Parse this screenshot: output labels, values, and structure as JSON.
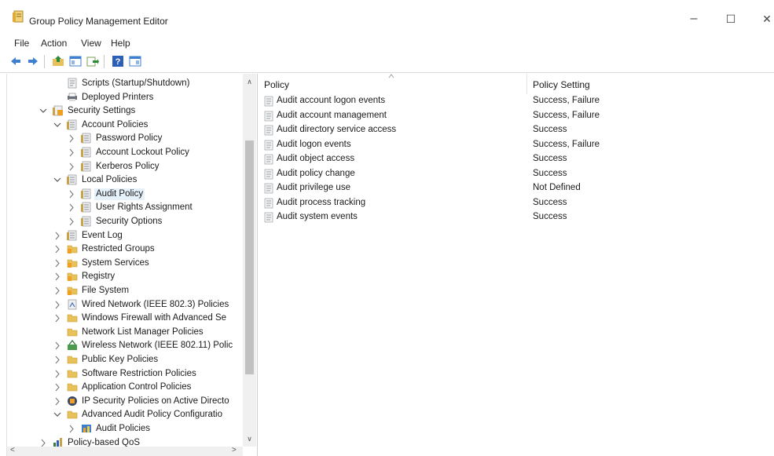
{
  "window": {
    "title": "Group Policy Management Editor",
    "minimize": "–",
    "maximize": "☐",
    "close": "✕"
  },
  "menu": [
    {
      "label": "File"
    },
    {
      "label": "Action"
    },
    {
      "label": "View"
    },
    {
      "label": "Help"
    }
  ],
  "toolbar": [
    {
      "name": "back-arrow-icon"
    },
    {
      "name": "forward-arrow-icon"
    },
    {
      "name": "up-folder-icon"
    },
    {
      "name": "show-hide-tree-icon"
    },
    {
      "name": "export-list-icon"
    },
    {
      "name": "help-icon"
    },
    {
      "name": "show-action-pane-icon"
    }
  ],
  "tree": [
    {
      "label": "Scripts (Startup/Shutdown)",
      "icon": "script-icon",
      "expand": ""
    },
    {
      "label": "Deployed Printers",
      "icon": "printer-icon",
      "expand": ""
    },
    {
      "label": "Security Settings",
      "icon": "security-icon",
      "expand": "expanded"
    },
    {
      "label": "Account Policies",
      "icon": "policy-icon",
      "expand": "expanded"
    },
    {
      "label": "Password Policy",
      "icon": "policy-icon",
      "expand": "collapsed"
    },
    {
      "label": "Account Lockout Policy",
      "icon": "policy-icon",
      "expand": "collapsed"
    },
    {
      "label": "Kerberos Policy",
      "icon": "policy-icon",
      "expand": "collapsed"
    },
    {
      "label": "Local Policies",
      "icon": "policy-icon",
      "expand": "expanded"
    },
    {
      "label": "Audit Policy",
      "icon": "policy-icon",
      "expand": "collapsed",
      "selected": true
    },
    {
      "label": "User Rights Assignment",
      "icon": "policy-icon",
      "expand": "collapsed"
    },
    {
      "label": "Security Options",
      "icon": "policy-icon",
      "expand": "collapsed"
    },
    {
      "label": "Event Log",
      "icon": "policy-icon",
      "expand": "collapsed"
    },
    {
      "label": "Restricted Groups",
      "icon": "locked-folder-icon",
      "expand": "collapsed"
    },
    {
      "label": "System Services",
      "icon": "locked-folder-icon",
      "expand": "collapsed"
    },
    {
      "label": "Registry",
      "icon": "locked-folder-icon",
      "expand": "collapsed"
    },
    {
      "label": "File System",
      "icon": "locked-folder-icon",
      "expand": "collapsed"
    },
    {
      "label": "Wired Network (IEEE 802.3) Policies",
      "icon": "wired-network-icon",
      "expand": "collapsed"
    },
    {
      "label": "Windows Firewall with Advanced Se",
      "icon": "folder-icon",
      "expand": "collapsed"
    },
    {
      "label": "Network List Manager Policies",
      "icon": "folder-icon",
      "expand": ""
    },
    {
      "label": "Wireless Network (IEEE 802.11) Polic",
      "icon": "wireless-network-icon",
      "expand": "collapsed"
    },
    {
      "label": "Public Key Policies",
      "icon": "folder-icon",
      "expand": "collapsed"
    },
    {
      "label": "Software Restriction Policies",
      "icon": "folder-icon",
      "expand": "collapsed"
    },
    {
      "label": "Application Control Policies",
      "icon": "folder-icon",
      "expand": "collapsed"
    },
    {
      "label": "IP Security Policies on Active Directo",
      "icon": "ip-security-icon",
      "expand": "collapsed"
    },
    {
      "label": "Advanced Audit Policy Configuratio",
      "icon": "folder-icon",
      "expand": "expanded"
    },
    {
      "label": "Audit Policies",
      "icon": "audit-policies-icon",
      "expand": "collapsed"
    },
    {
      "label": "Policy-based QoS",
      "icon": "qos-chart-icon",
      "expand": "collapsed"
    }
  ],
  "list": {
    "columns": {
      "policy": "Policy",
      "setting": "Policy Setting"
    },
    "rows": [
      {
        "policy": "Audit account logon events",
        "setting": "Success, Failure"
      },
      {
        "policy": "Audit account management",
        "setting": "Success, Failure"
      },
      {
        "policy": "Audit directory service access",
        "setting": "Success"
      },
      {
        "policy": "Audit logon events",
        "setting": "Success, Failure"
      },
      {
        "policy": "Audit object access",
        "setting": "Success"
      },
      {
        "policy": "Audit policy change",
        "setting": "Success"
      },
      {
        "policy": "Audit privilege use",
        "setting": "Not Defined"
      },
      {
        "policy": "Audit process tracking",
        "setting": "Success"
      },
      {
        "policy": "Audit system events",
        "setting": "Success"
      }
    ]
  },
  "scroll_glyphs": {
    "up": "∧",
    "down": "∨",
    "left": "<",
    "right": ">"
  },
  "colors": {
    "selection": "#e5f1fb",
    "folder": "#e8c15a",
    "background": "#ffffff"
  }
}
